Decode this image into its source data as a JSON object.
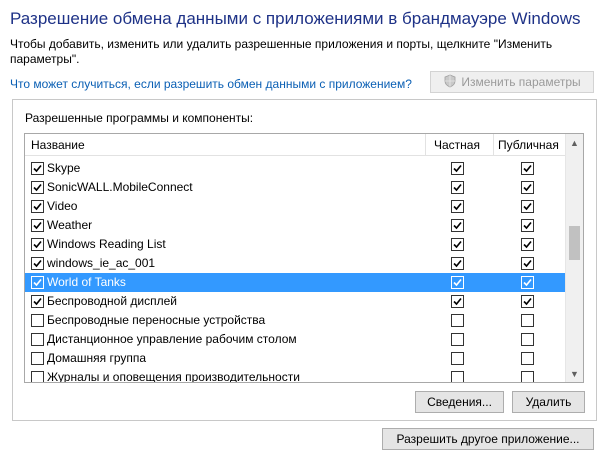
{
  "title": "Разрешение обмена данными с приложениями в брандмауэре Windows",
  "instructions": "Чтобы добавить, изменить или удалить разрешенные приложения и порты, щелкните \"Изменить параметры\".",
  "help_link": "Что может случиться, если разрешить обмен данными с приложением?",
  "change_settings_button": {
    "label": "Изменить параметры",
    "icon": "shield-icon",
    "enabled": false
  },
  "group": {
    "label": "Разрешенные программы и компоненты:",
    "columns": {
      "name": "Название",
      "private": "Частная",
      "public": "Публичная"
    },
    "rows": [
      {
        "name": "Skype",
        "enabled": true,
        "private": true,
        "public": true,
        "selected": false
      },
      {
        "name": "SonicWALL.MobileConnect",
        "enabled": true,
        "private": true,
        "public": true,
        "selected": false
      },
      {
        "name": "Video",
        "enabled": true,
        "private": true,
        "public": true,
        "selected": false
      },
      {
        "name": "Weather",
        "enabled": true,
        "private": true,
        "public": true,
        "selected": false
      },
      {
        "name": "Windows Reading List",
        "enabled": true,
        "private": true,
        "public": true,
        "selected": false
      },
      {
        "name": "windows_ie_ac_001",
        "enabled": true,
        "private": true,
        "public": true,
        "selected": false
      },
      {
        "name": "World of Tanks",
        "enabled": true,
        "private": true,
        "public": true,
        "selected": true
      },
      {
        "name": "Беспроводной дисплей",
        "enabled": true,
        "private": true,
        "public": true,
        "selected": false
      },
      {
        "name": "Беспроводные переносные устройства",
        "enabled": false,
        "private": false,
        "public": false,
        "selected": false
      },
      {
        "name": "Дистанционное управление рабочим столом",
        "enabled": false,
        "private": false,
        "public": false,
        "selected": false
      },
      {
        "name": "Домашняя группа",
        "enabled": false,
        "private": false,
        "public": false,
        "selected": false
      },
      {
        "name": "Журналы и оповещения производительности",
        "enabled": false,
        "private": false,
        "public": false,
        "selected": false
      }
    ],
    "details_button": "Сведения...",
    "remove_button": "Удалить"
  },
  "allow_other_app_button": "Разрешить другое приложение...",
  "colors": {
    "title": "#1e3287",
    "link": "#0a5fb4",
    "selection": "#3399ff"
  }
}
